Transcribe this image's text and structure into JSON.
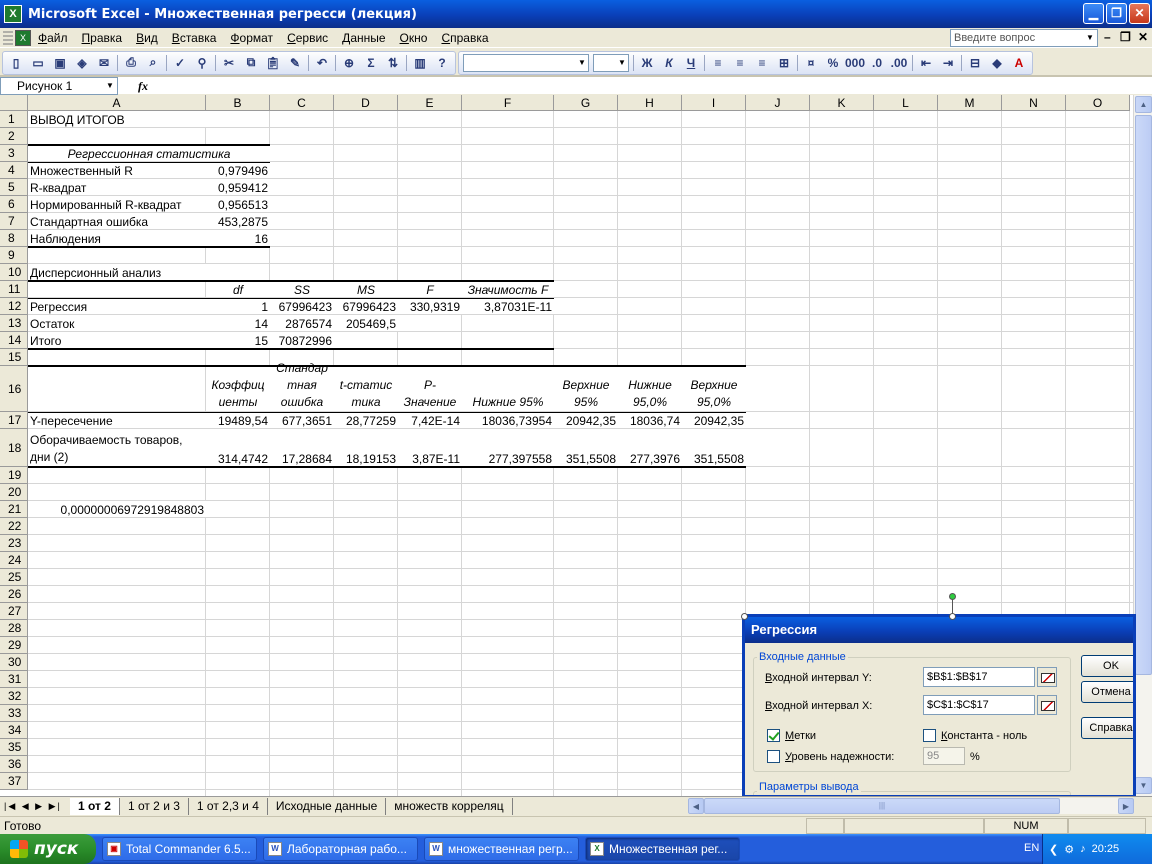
{
  "window": {
    "title": "Microsoft Excel - Множественная регресси (лекция)"
  },
  "menu": [
    "Файл",
    "Правка",
    "Вид",
    "Вставка",
    "Формат",
    "Сервис",
    "Данные",
    "Окно",
    "Справка"
  ],
  "help_placeholder": "Введите вопрос",
  "namebox": "Рисунок 1",
  "fx_label": "fx",
  "columns": [
    "A",
    "B",
    "C",
    "D",
    "E",
    "F",
    "G",
    "H",
    "I",
    "J",
    "K",
    "L",
    "M",
    "N",
    "O"
  ],
  "rows": [
    "1",
    "2",
    "3",
    "4",
    "5",
    "6",
    "7",
    "8",
    "9",
    "10",
    "11",
    "12",
    "13",
    "14",
    "15",
    "16",
    "17",
    "18",
    "19",
    "20",
    "21",
    "22",
    "23",
    "24",
    "25",
    "26",
    "27",
    "28",
    "29",
    "30",
    "31",
    "32",
    "33",
    "34",
    "35",
    "36",
    "37"
  ],
  "cells": {
    "a1": "ВЫВОД ИТОГОВ",
    "a3": "Регрессионная статистика",
    "stats": [
      {
        "label": "Множественный R",
        "value": "0,979496"
      },
      {
        "label": "R-квадрат",
        "value": "0,959412"
      },
      {
        "label": "Нормированный R-квадрат",
        "value": "0,956513"
      },
      {
        "label": "Стандартная ошибка",
        "value": "453,2875"
      },
      {
        "label": "Наблюдения",
        "value": "16"
      }
    ],
    "a10": "Дисперсионный анализ",
    "anova_headers": [
      "df",
      "SS",
      "MS",
      "F",
      "Значимость F"
    ],
    "anova": [
      {
        "label": "Регрессия",
        "df": "1",
        "ss": "67996423",
        "ms": "67996423",
        "f": "330,9319",
        "sig": "3,87031E-11"
      },
      {
        "label": "Остаток",
        "df": "14",
        "ss": "2876574",
        "ms": "205469,5"
      },
      {
        "label": "Итого",
        "df": "15",
        "ss": "70872996"
      }
    ],
    "coef_headers": [
      "Коэффиц иенты",
      "Стандар тная ошибка",
      "t-статис тика",
      "P-Значение",
      "Нижние 95%",
      "Верхние 95%",
      "Нижние 95,0%",
      "Верхние 95,0%"
    ],
    "coef": [
      {
        "label": "Y-пересечение",
        "v": [
          "19489,54",
          "677,3651",
          "28,77259",
          "7,42E-14",
          "18036,73954",
          "20942,35",
          "18036,74",
          "20942,35"
        ]
      },
      {
        "label": "Оборачиваемость товаров, дни (2)",
        "v": [
          "314,4742",
          "17,28684",
          "18,19153",
          "3,87E-11",
          "277,397558",
          "351,5508",
          "277,3976",
          "351,5508"
        ]
      }
    ],
    "a21": "0,00000006972919848803"
  },
  "sheets": [
    "1 от 2",
    "1 от 2 и 3",
    "1 от 2,3 и 4",
    "Исходные данные",
    "множеств корреляц"
  ],
  "status": {
    "ready": "Готово",
    "num": "NUM"
  },
  "dialog": {
    "title": "Регрессия",
    "input_group": "Входные данные",
    "y_label": "Входной интервал Y:",
    "y_value": "$B$1:$B$17",
    "x_label": "Входной интервал X:",
    "x_value": "$C$1:$C$17",
    "labels_chk": "Метки",
    "const_chk": "Константа - ноль",
    "conf_chk": "Уровень надежности:",
    "conf_value": "95",
    "pct": "%",
    "output_group": "Параметры вывода",
    "ok": "OK",
    "cancel": "Отмена",
    "help": "Справка"
  },
  "taskbar": {
    "start": "пуск",
    "tasks": [
      "Total Commander 6.5...",
      "Лабораторная рабо...",
      "множественная регр...",
      "Множественная рег..."
    ],
    "lang": "EN",
    "clock": "20:25"
  }
}
